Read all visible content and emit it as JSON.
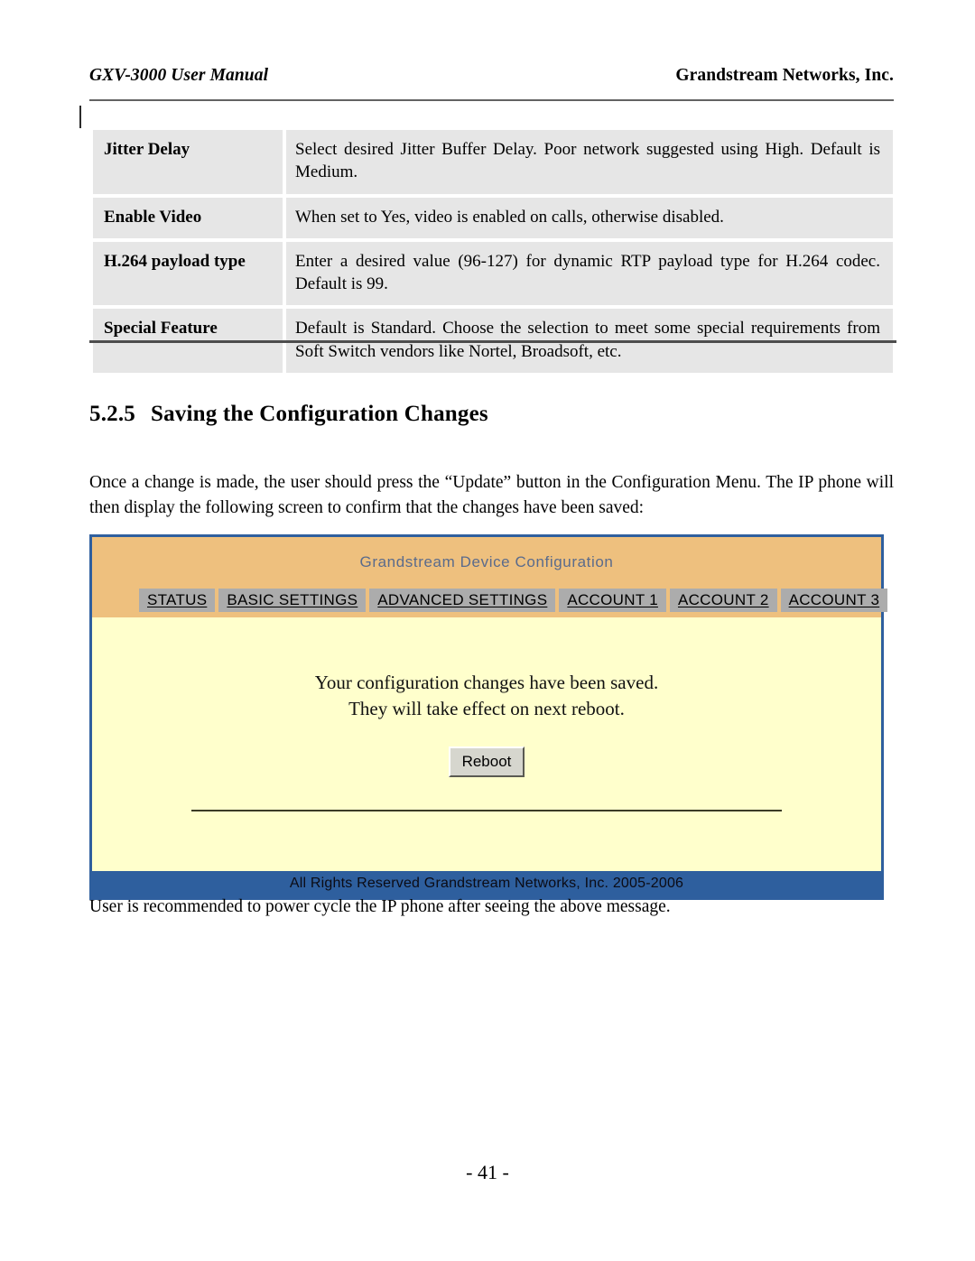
{
  "header": {
    "left": "GXV-3000 User Manual",
    "right": "Grandstream Networks, Inc."
  },
  "settings_table": {
    "rows": [
      {
        "term": "Jitter Delay",
        "description": "Select desired Jitter Buffer Delay. Poor network suggested using High. Default is Medium."
      },
      {
        "term": "Enable Video",
        "description": "When set to Yes, video is enabled on calls, otherwise disabled."
      },
      {
        "term": "H.264 payload type",
        "description": "Enter a desired value (96-127) for dynamic RTP payload type for H.264 codec. Default is 99."
      },
      {
        "term": "Special Feature",
        "description": "Default is Standard. Choose the selection to meet some special requirements from Soft Switch vendors like Nortel, Broadsoft, etc."
      }
    ]
  },
  "section": {
    "number": "5.2.5",
    "title": "Saving the Configuration Changes"
  },
  "paragraphs": {
    "intro": "Once a change is made, the user should press the “Update” button in the Configuration Menu. The IP phone will then display the following screen to confirm that the changes have been saved:",
    "outro": "User is recommended to power cycle the IP phone after seeing the above message."
  },
  "device_screenshot": {
    "title": "Grandstream Device Configuration",
    "tabs": [
      {
        "label": "STATUS"
      },
      {
        "label": "BASIC SETTINGS"
      },
      {
        "label": "ADVANCED SETTINGS"
      },
      {
        "label": "ACCOUNT 1"
      },
      {
        "label": "ACCOUNT 2"
      },
      {
        "label": "ACCOUNT 3"
      }
    ],
    "message_line1": "Your configuration changes have been saved.",
    "message_line2": "They will take effect on next reboot.",
    "reboot_label": "Reboot",
    "footer": "All Rights Reserved Grandstream Networks, Inc. 2005-2006",
    "colors": {
      "border": "#2f5f9e",
      "header_bg": "#eec07e",
      "title_text": "#5a6b8c",
      "tab_bg": "#acacac",
      "body_bg": "#ffffcc",
      "footer_bg": "#2e5f9e",
      "button_face": "#d6d6ce"
    }
  },
  "page_number": "- 41 -"
}
